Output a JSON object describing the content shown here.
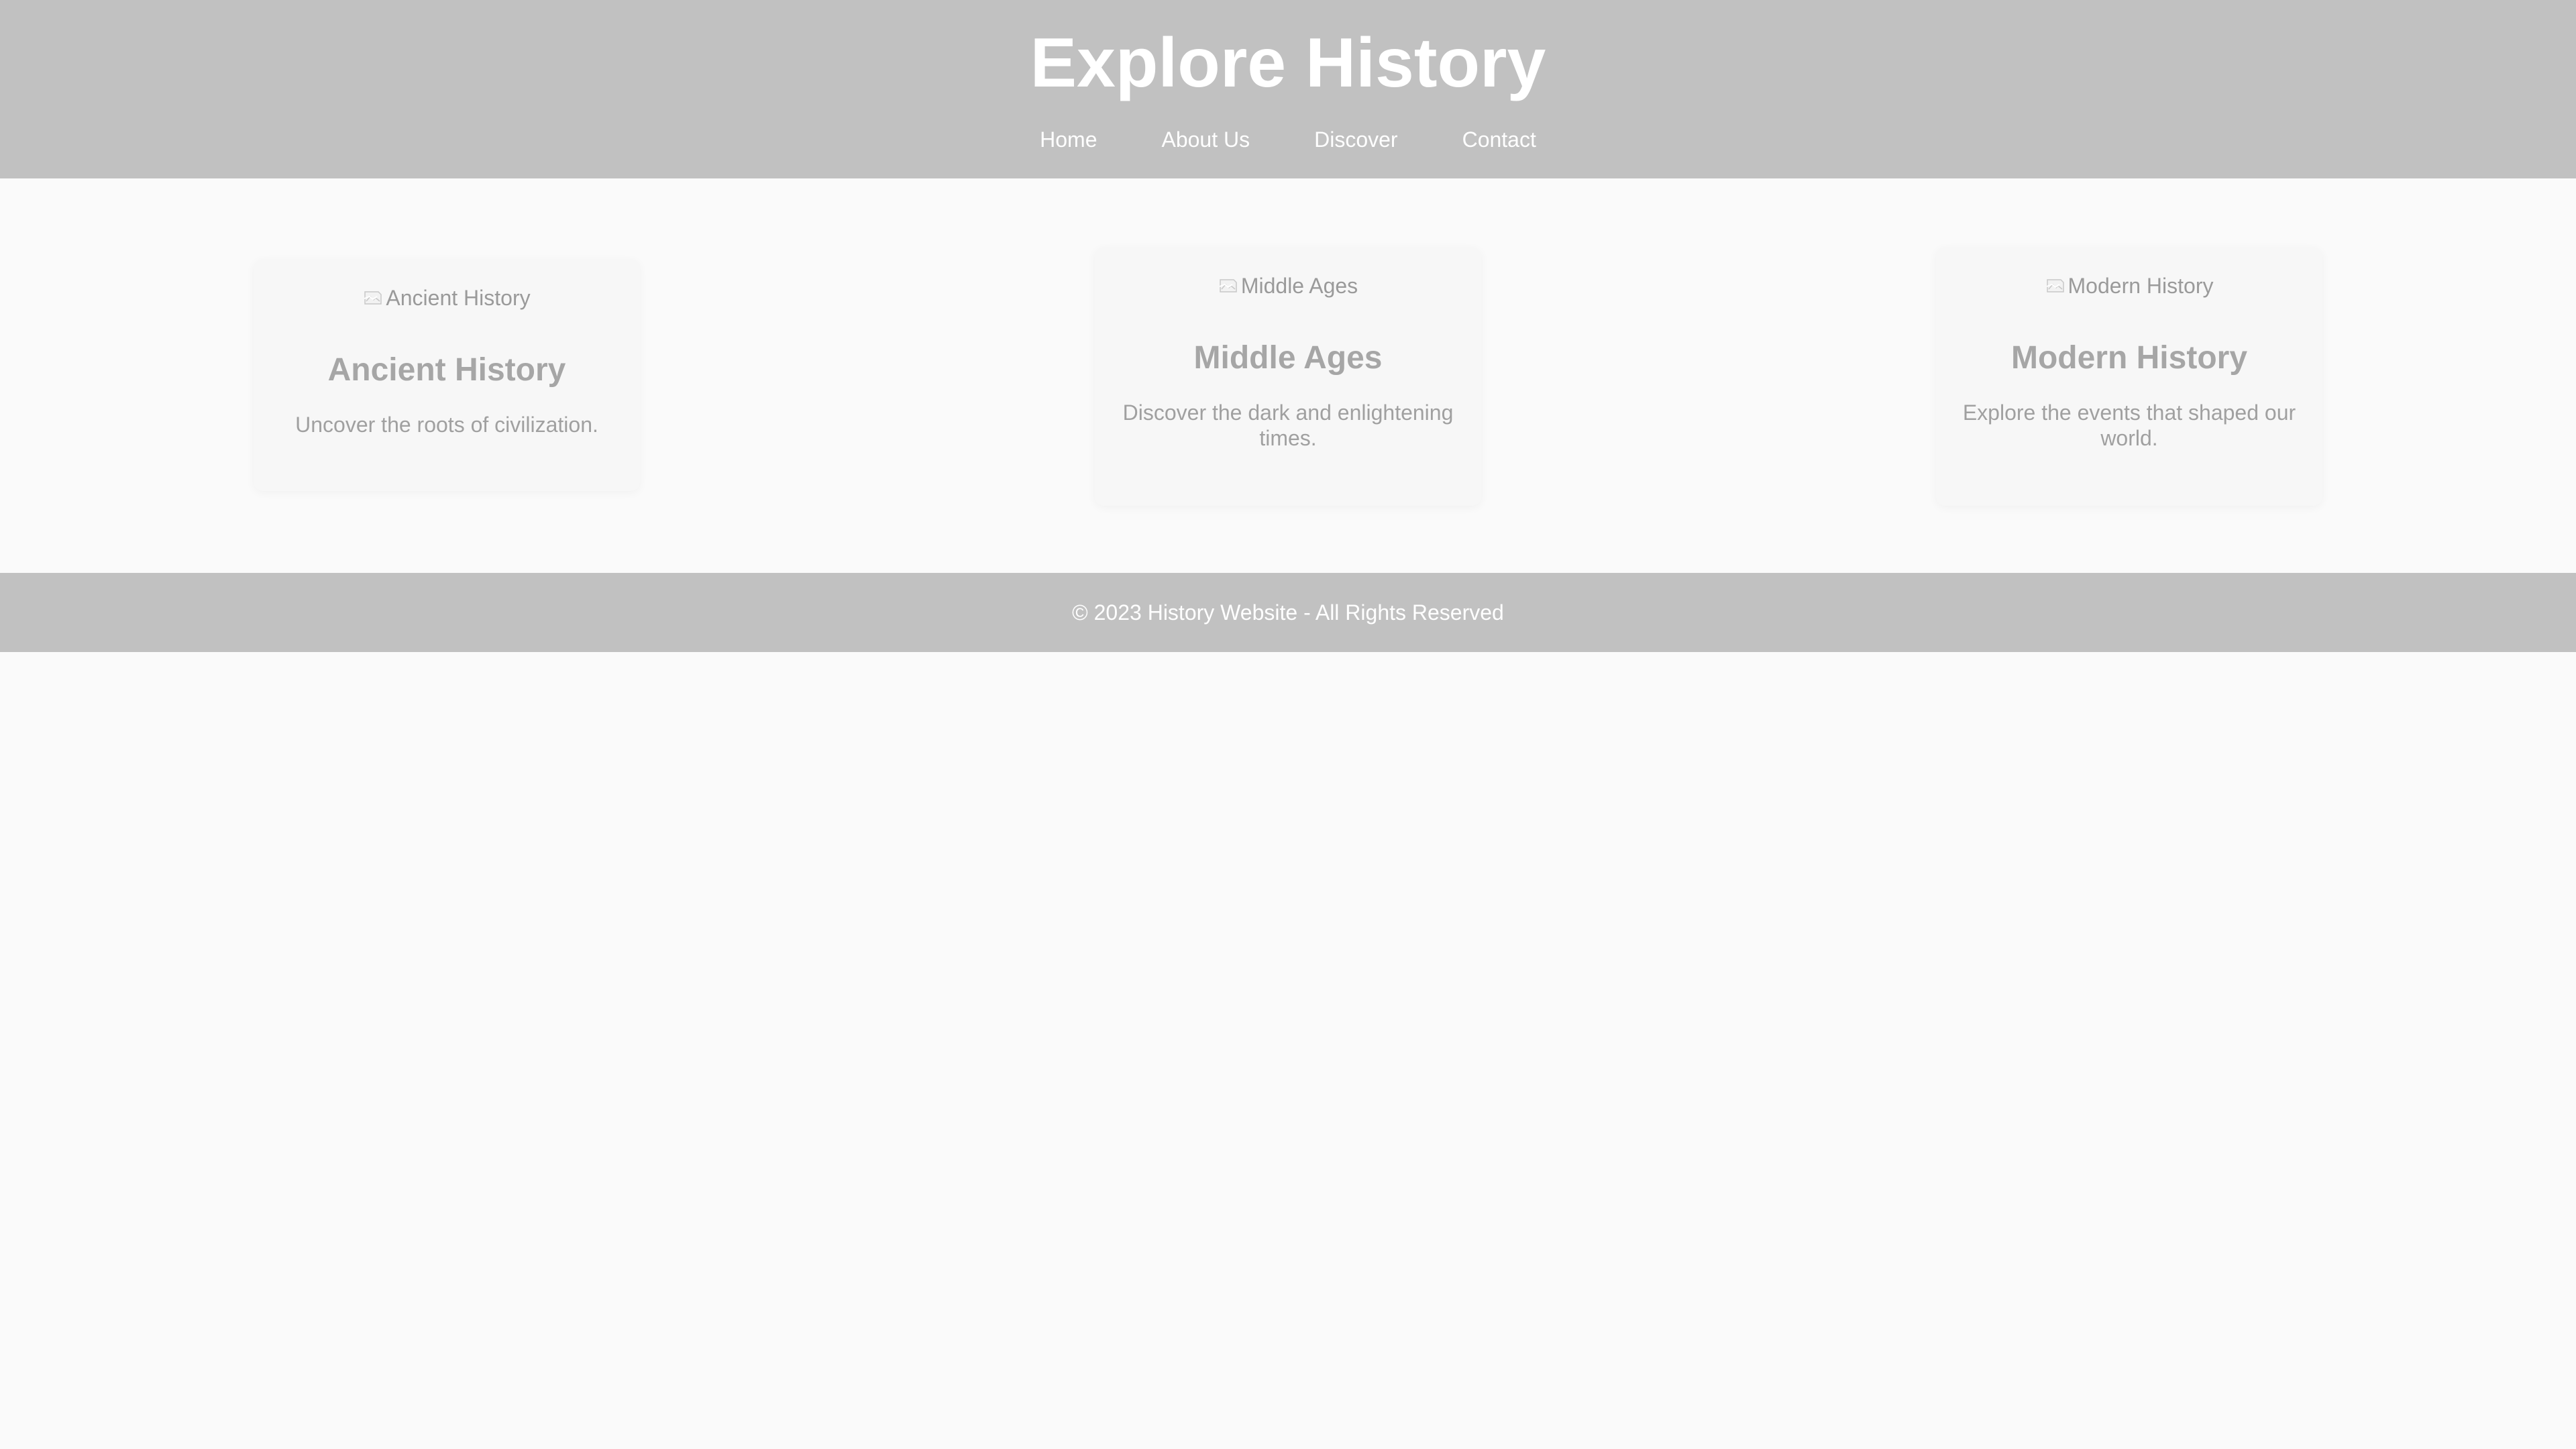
{
  "header": {
    "title": "Explore History",
    "nav": [
      {
        "label": "Home"
      },
      {
        "label": "About Us"
      },
      {
        "label": "Discover"
      },
      {
        "label": "Contact"
      }
    ]
  },
  "cards": [
    {
      "image_alt": "Ancient History",
      "title": "Ancient History",
      "description": "Uncover the roots of civilization."
    },
    {
      "image_alt": "Middle Ages",
      "title": "Middle Ages",
      "description": "Discover the dark and enlightening times."
    },
    {
      "image_alt": "Modern History",
      "title": "Modern History",
      "description": "Explore the events that shaped our world."
    }
  ],
  "footer": {
    "text": "© 2023 History Website - All Rights Reserved"
  },
  "colors": {
    "header_bg": "#c1c1c1",
    "page_bg": "#fafafa",
    "card_bg": "#f7f7f7",
    "text_light": "#ffffff",
    "text_muted": "#a0a0a0"
  },
  "icons": [
    "broken-image-icon"
  ]
}
